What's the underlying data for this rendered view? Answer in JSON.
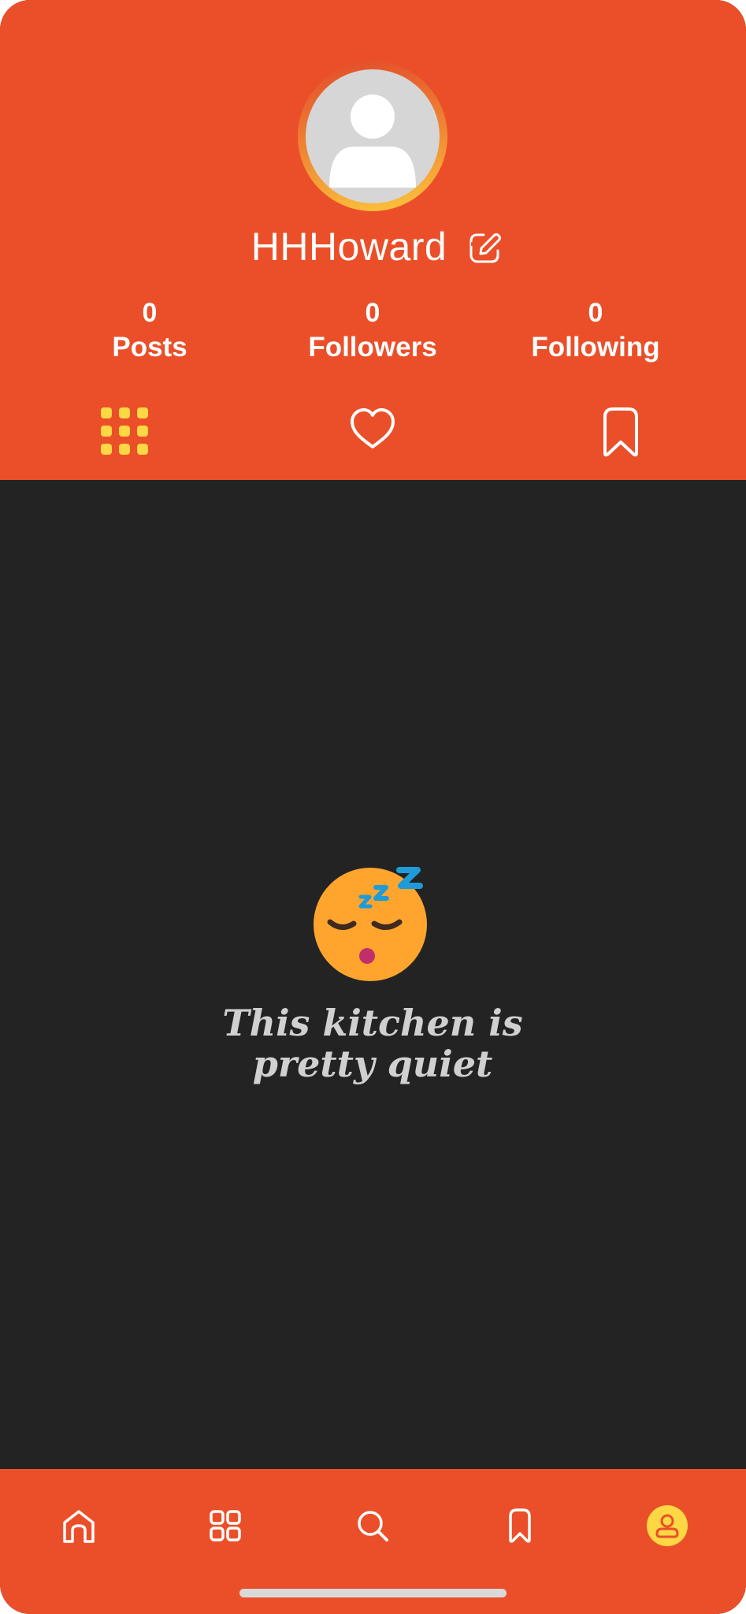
{
  "profile": {
    "username": "HHHoward",
    "avatar_icon": "default-user-avatar-icon",
    "edit_icon": "edit-icon"
  },
  "stats": {
    "posts": {
      "count": "0",
      "label": "Posts"
    },
    "followers": {
      "count": "0",
      "label": "Followers"
    },
    "following": {
      "count": "0",
      "label": "Following"
    }
  },
  "tabs": [
    {
      "icon": "grid-icon",
      "active": true
    },
    {
      "icon": "heart-icon",
      "active": false
    },
    {
      "icon": "bookmark-icon",
      "active": false
    }
  ],
  "empty_state": {
    "emoji_icon": "sleeping-face-icon",
    "message": "This kitchen is pretty quiet"
  },
  "bottom_nav": [
    {
      "icon": "home-icon",
      "active": false
    },
    {
      "icon": "grid-icon",
      "active": false
    },
    {
      "icon": "search-icon",
      "active": false
    },
    {
      "icon": "bookmark-icon",
      "active": false
    },
    {
      "icon": "profile-icon",
      "active": true
    }
  ],
  "colors": {
    "primary": "#EB4F29",
    "accent": "#FDD744",
    "background": "#232323",
    "text_light": "#FFFFFF",
    "text_muted": "#D0D0D0"
  }
}
